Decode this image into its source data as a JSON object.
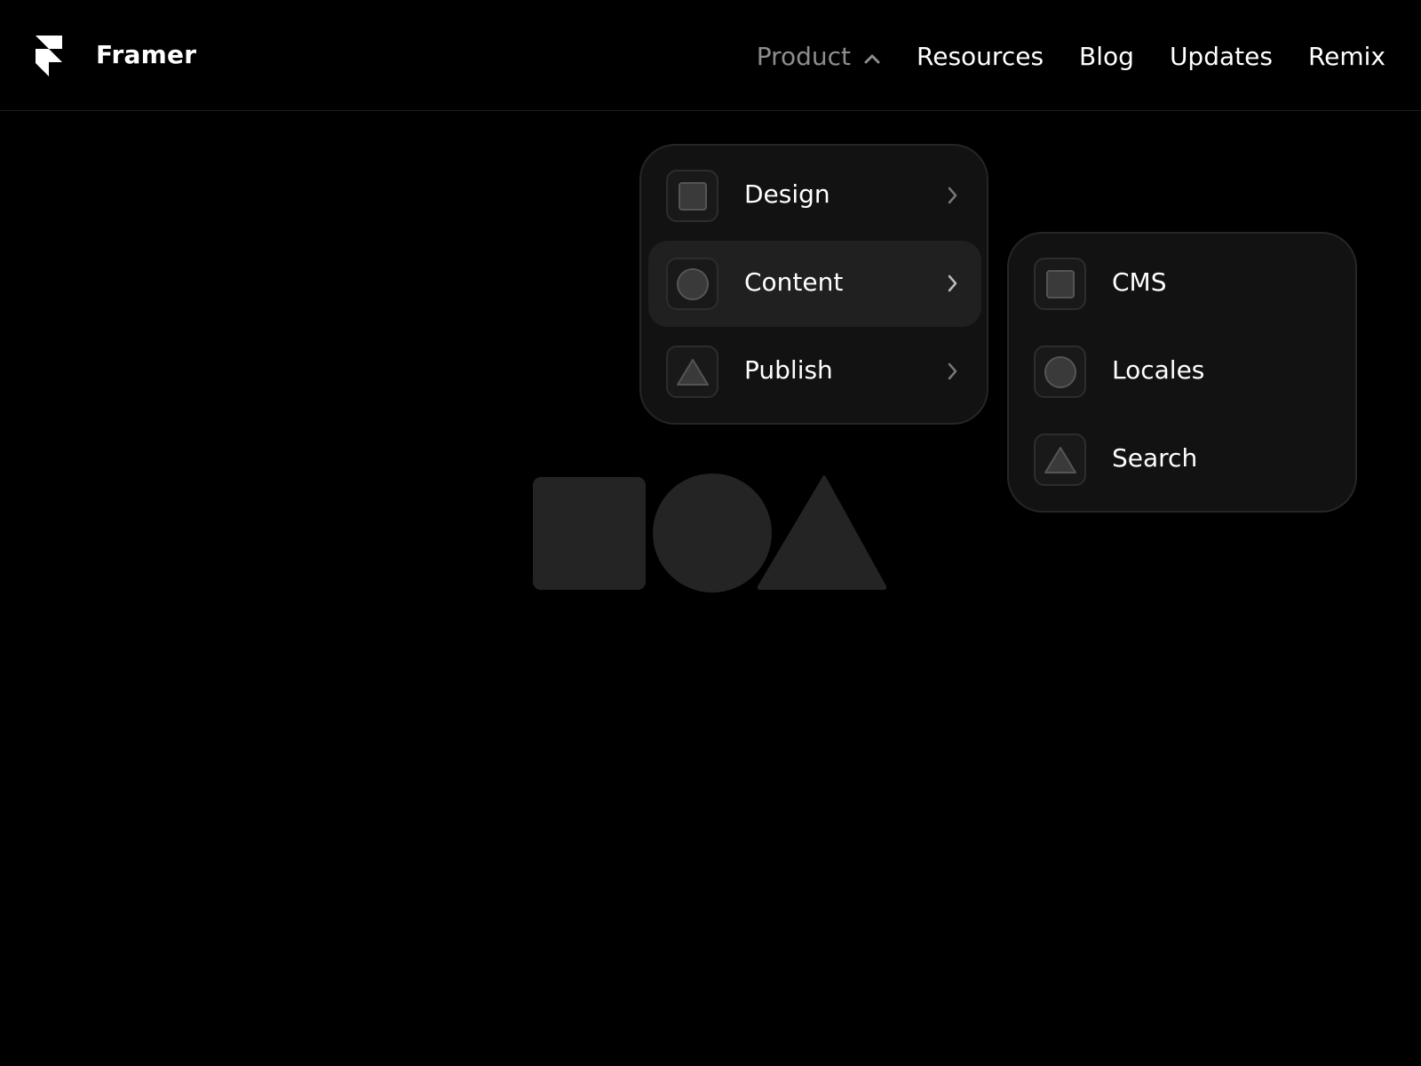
{
  "header": {
    "brand_name": "Framer",
    "logo_icon": "framer-logo-icon",
    "nav": [
      {
        "label": "Product",
        "active": true,
        "icon": "chevron-up-icon"
      },
      {
        "label": "Resources"
      },
      {
        "label": "Blog"
      },
      {
        "label": "Updates"
      },
      {
        "label": "Remix"
      }
    ]
  },
  "product_menu": {
    "items": [
      {
        "label": "Design",
        "icon": "square-icon",
        "trailing_icon": "chevron-right-icon"
      },
      {
        "label": "Content",
        "icon": "circle-icon",
        "trailing_icon": "chevron-right-icon",
        "highlighted": true
      },
      {
        "label": "Publish",
        "icon": "triangle-icon",
        "trailing_icon": "chevron-right-icon"
      }
    ]
  },
  "content_submenu": {
    "items": [
      {
        "label": "CMS",
        "icon": "square-icon"
      },
      {
        "label": "Locales",
        "icon": "circle-icon"
      },
      {
        "label": "Search",
        "icon": "triangle-icon"
      }
    ]
  },
  "hero": {
    "shapes": [
      "square-shape",
      "circle-shape",
      "triangle-shape"
    ]
  },
  "colors": {
    "background": "#000000",
    "text": "#ffffff",
    "nav_active": "#8d8d8d",
    "menu_background": "#121212",
    "menu_border": "#262626",
    "menu_highlight": "#202020",
    "hero_shape": "#242424"
  }
}
